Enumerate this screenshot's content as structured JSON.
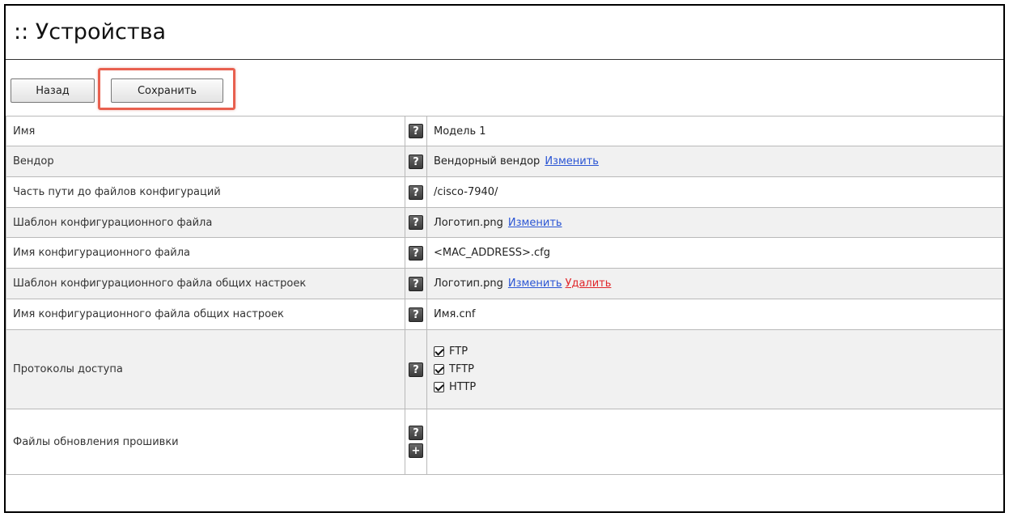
{
  "page": {
    "title": ":: Устройства"
  },
  "toolbar": {
    "back_label": "Назад",
    "save_label": "Сохранить"
  },
  "help_label": "?",
  "add_label": "+",
  "fields": {
    "name": {
      "label": "Имя",
      "value": "Модель 1"
    },
    "vendor": {
      "label": "Вендор",
      "value": "Вендорный вендор",
      "change_link": "Изменить"
    },
    "config_path": {
      "label": "Часть пути до файлов конфигураций",
      "value": "/cisco-7940/"
    },
    "config_template": {
      "label": "Шаблон конфигурационного файла",
      "value": "Логотип.png",
      "change_link": "Изменить"
    },
    "config_name": {
      "label": "Имя конфигурационного файла",
      "value": "<MAC_ADDRESS>.cfg"
    },
    "common_template": {
      "label": "Шаблон конфигурационного файла общих настроек",
      "value": "Логотип.png",
      "change_link": "Изменить",
      "delete_link": "Удалить"
    },
    "common_name": {
      "label": "Имя конфигурационного файла общих настроек",
      "value": "Имя.cnf"
    },
    "protocols": {
      "label": "Протоколы доступа",
      "options": [
        {
          "label": "FTP",
          "checked": true
        },
        {
          "label": "TFTP",
          "checked": true
        },
        {
          "label": "HTTP",
          "checked": true
        }
      ]
    },
    "firmware": {
      "label": "Файлы обновления прошивки"
    }
  },
  "colors": {
    "link": "#2a55d4",
    "delete_link": "#e0262a",
    "highlight": "#e8604f",
    "row_alt": "#f1f1f1"
  }
}
